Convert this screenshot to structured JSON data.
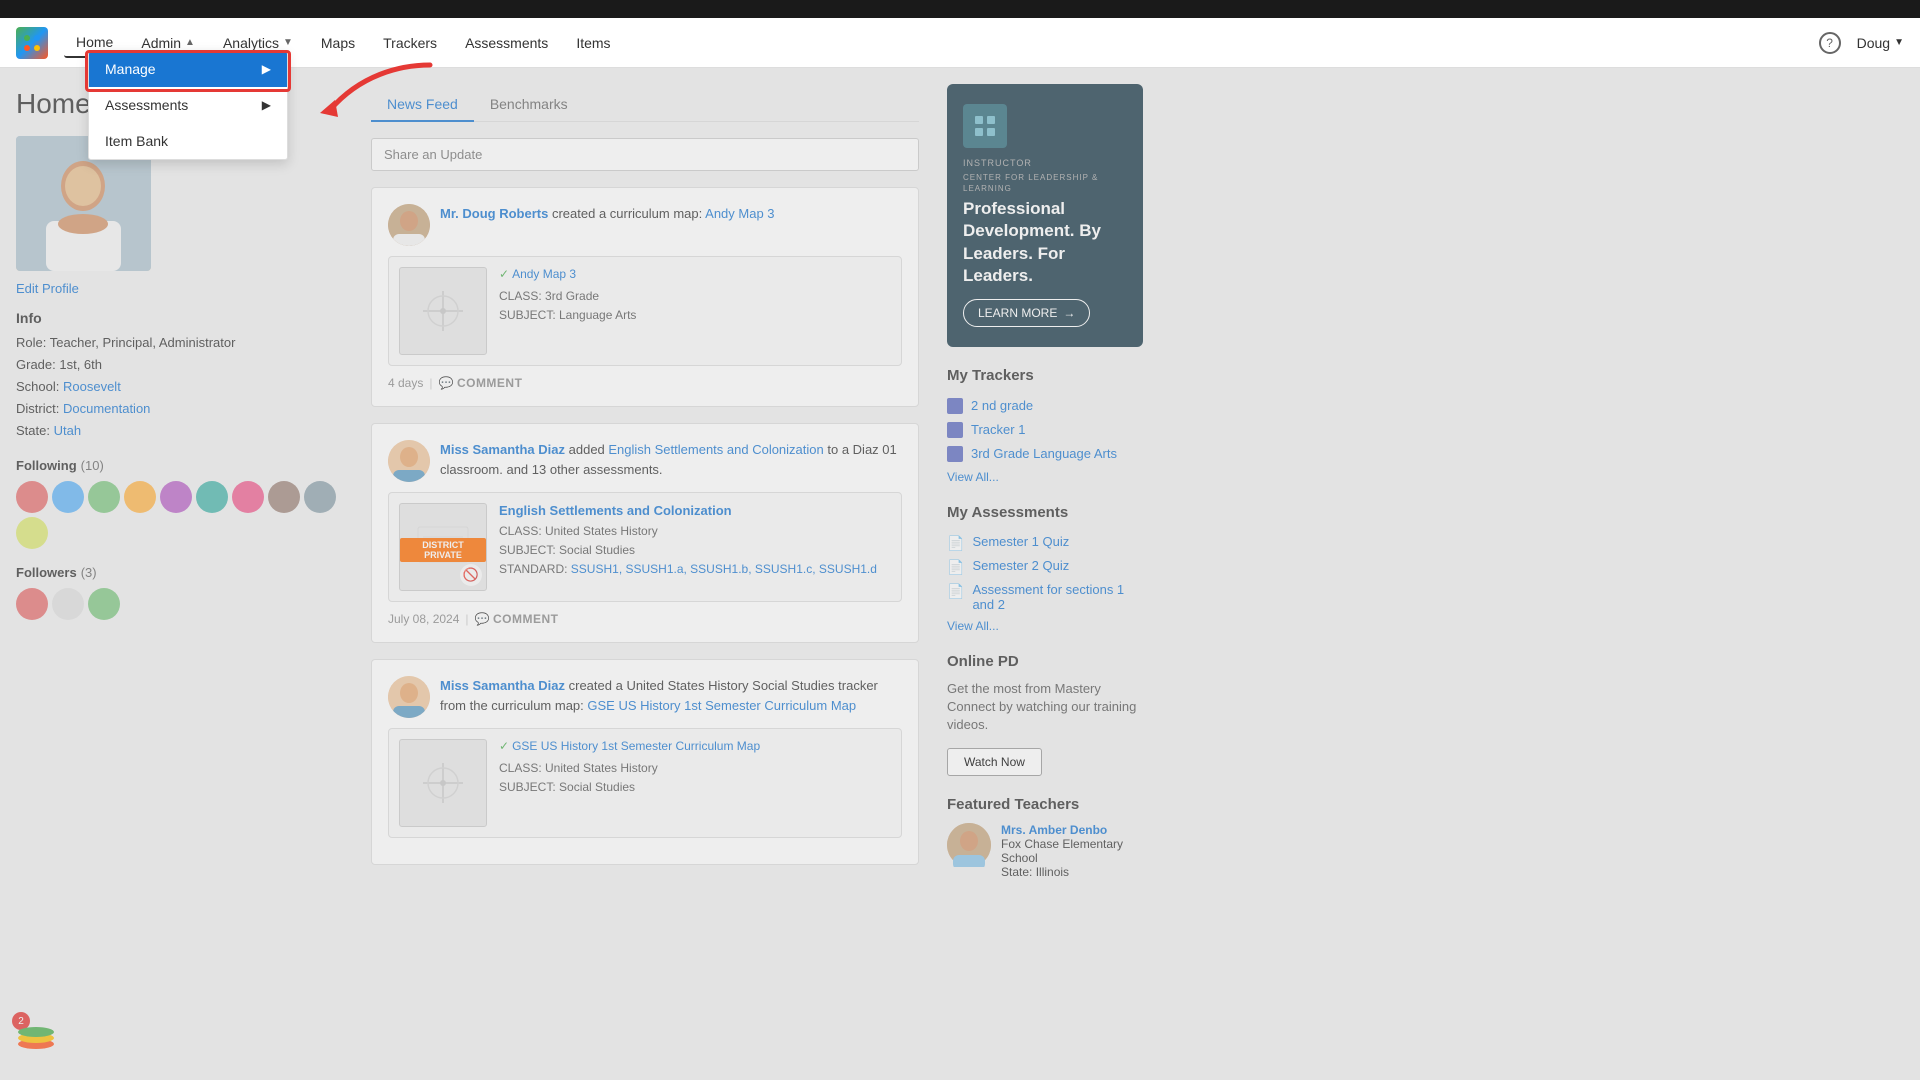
{
  "topbar": {},
  "navbar": {
    "logo_alt": "MasteryConnect Logo",
    "items": [
      {
        "label": "Home",
        "id": "home",
        "active": true
      },
      {
        "label": "Admin",
        "id": "admin",
        "has_dropdown": true,
        "chevron": "▲"
      },
      {
        "label": "Analytics",
        "id": "analytics",
        "has_dropdown": true,
        "chevron": "▼"
      },
      {
        "label": "Maps",
        "id": "maps"
      },
      {
        "label": "Trackers",
        "id": "trackers"
      },
      {
        "label": "Assessments",
        "id": "assessments"
      },
      {
        "label": "Items",
        "id": "items"
      }
    ],
    "help_label": "?",
    "user_name": "Doug",
    "user_chevron": "▼"
  },
  "dropdown": {
    "items": [
      {
        "label": "Manage",
        "id": "manage",
        "arrow": "▶",
        "active": true
      },
      {
        "label": "Assessments",
        "id": "assessments-sub",
        "arrow": "▶"
      },
      {
        "label": "Item Bank",
        "id": "item-bank"
      }
    ]
  },
  "page_title": "Home",
  "profile": {
    "edit_link": "Edit Profile",
    "info_title": "Info",
    "role": "Role: Teacher, Principal, Administrator",
    "grade": "Grade: 1st, 6th",
    "school_label": "School:",
    "school_name": "Roosevelt",
    "district_label": "District:",
    "district_name": "Documentation",
    "state_label": "State:",
    "state_name": "Utah",
    "following_label": "Following",
    "following_count": "(10)",
    "followers_label": "Followers",
    "followers_count": "(3)"
  },
  "feed": {
    "tabs": [
      {
        "label": "News Feed",
        "id": "news-feed",
        "active": true
      },
      {
        "label": "Benchmarks",
        "id": "benchmarks"
      }
    ],
    "share_placeholder": "Share an Update",
    "items": [
      {
        "id": "feed1",
        "user": "Mr. Doug Roberts",
        "action": " created a curriculum map: ",
        "link": "Andy Map 3",
        "avatar_class": "doug",
        "map_title": "Andy Map 3",
        "map_verified_label": "Andy Map 3",
        "map_class": "CLASS: 3rd Grade",
        "map_subject": "SUBJECT: Language Arts",
        "time": "4 days",
        "comment_label": "COMMENT"
      },
      {
        "id": "feed2",
        "user": "Miss Samantha Diaz",
        "action": " added ",
        "link": "English Settlements and Colonization",
        "action2": " to a Diaz 01 classroom. and 13 other assessments.",
        "avatar_class": "samantha",
        "map_title": "English Settlements and Colonization",
        "map_class": "CLASS: United States History",
        "map_subject": "SUBJECT: Social Studies",
        "map_standard": "STANDARD:",
        "map_standards": "SSUSH1, SSUSH1.a, SSUSH1.b, SSUSH1.c, SSUSH1.d",
        "district_private": "DISTRICT PRIVATE",
        "time": "July 08, 2024",
        "comment_label": "COMMENT"
      },
      {
        "id": "feed3",
        "user": "Miss Samantha Diaz",
        "action": " created a United States History Social Studies tracker from the curriculum map: ",
        "link": "GSE US History 1st Semester Curriculum Map",
        "avatar_class": "samantha",
        "map_title": "GSE US History 1st Semester Curriculum Map",
        "map_class": "CLASS: United States History",
        "map_subject": "SUBJECT: Social Studies",
        "time": "",
        "comment_label": "COMMENT"
      }
    ]
  },
  "right_panel": {
    "ad": {
      "small_text": "INSTRUCTOR",
      "org_name": "CENTER FOR LEADERSHIP & LEARNING",
      "title": "Professional Development. By Leaders. For Leaders.",
      "button_label": "LEARN MORE"
    },
    "my_trackers": {
      "title": "My Trackers",
      "items": [
        {
          "label": "2 nd grade"
        },
        {
          "label": "Tracker 1"
        },
        {
          "label": "3rd Grade Language Arts"
        }
      ],
      "view_all": "View All..."
    },
    "my_assessments": {
      "title": "My Assessments",
      "items": [
        {
          "label": "Semester 1 Quiz"
        },
        {
          "label": "Semester 2 Quiz"
        },
        {
          "label": "Assessment for sections 1 and 2"
        }
      ],
      "view_all": "View All..."
    },
    "online_pd": {
      "title": "Online PD",
      "text": "Get the most from Mastery Connect by watching our training videos.",
      "button": "Watch Now"
    },
    "featured_teachers": {
      "title": "Featured Teachers",
      "teacher": {
        "name": "Mrs. Amber Denbo",
        "school": "Fox Chase Elementary School",
        "state": "State: Illinois"
      }
    }
  },
  "notification_badge": "2"
}
